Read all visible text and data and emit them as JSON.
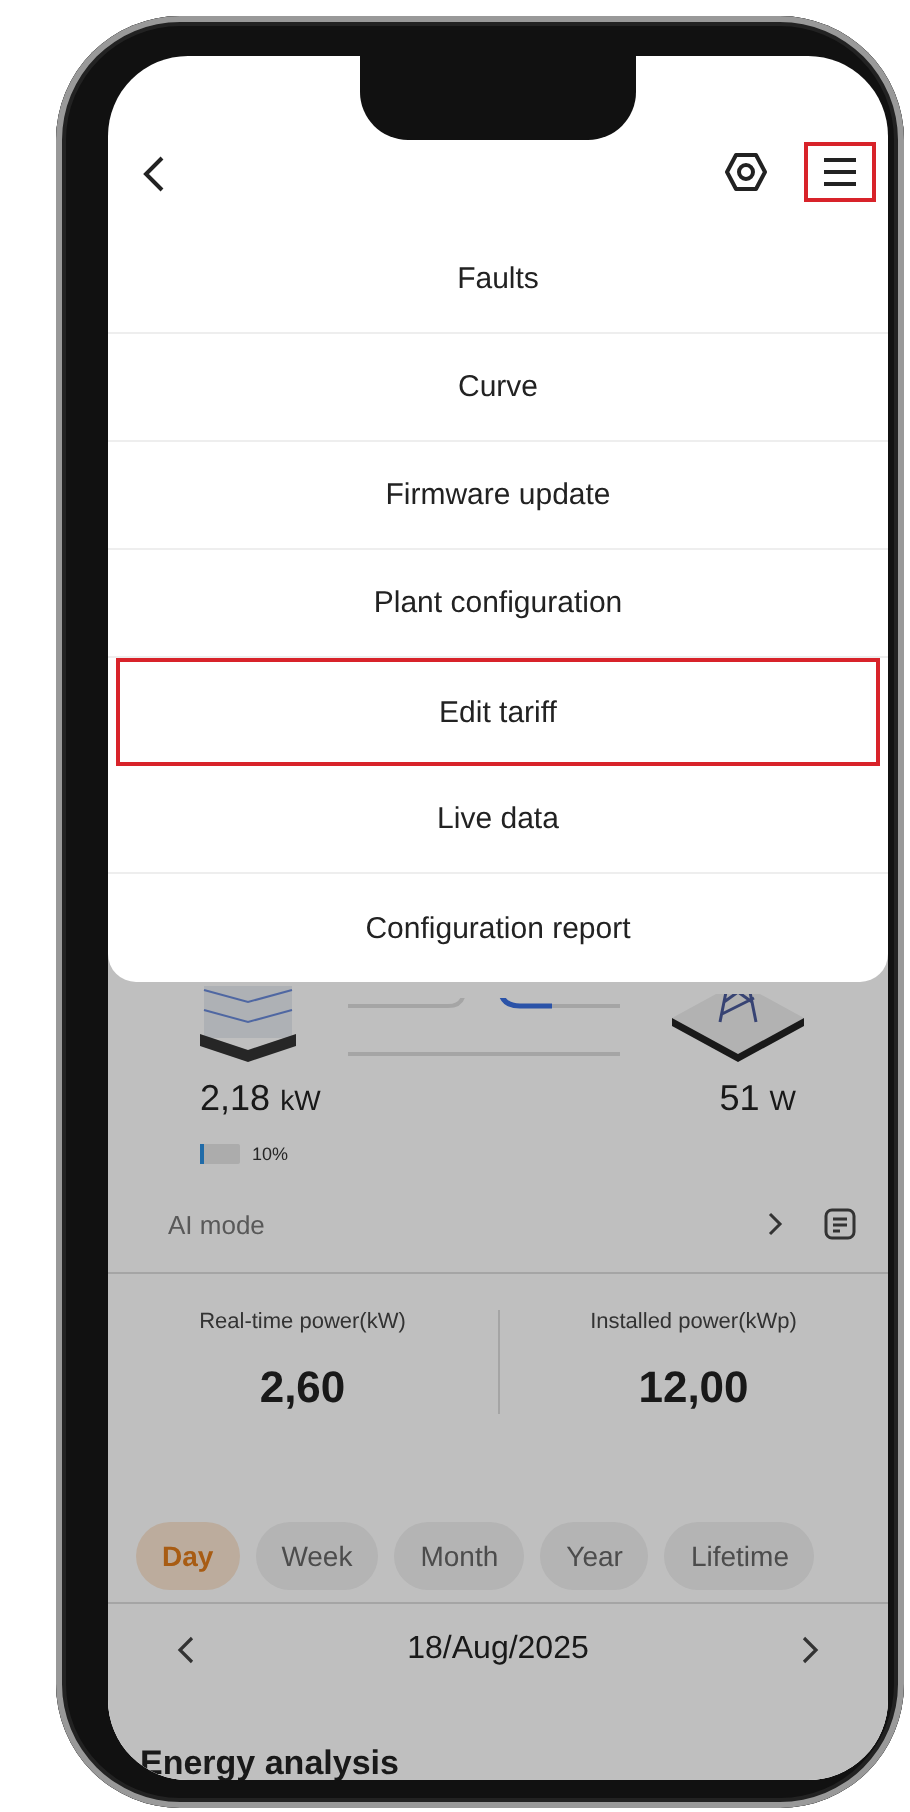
{
  "header": {
    "menu_button": {
      "highlighted": true
    }
  },
  "menu": {
    "items": [
      {
        "label": "Faults",
        "highlighted": false
      },
      {
        "label": "Curve",
        "highlighted": false
      },
      {
        "label": "Firmware update",
        "highlighted": false
      },
      {
        "label": "Plant configuration",
        "highlighted": false
      },
      {
        "label": "Edit tariff",
        "highlighted": true
      },
      {
        "label": "Live data",
        "highlighted": false
      },
      {
        "label": "Configuration report",
        "highlighted": false
      }
    ]
  },
  "energy_flow": {
    "battery": {
      "value": "2,18",
      "unit": "kW",
      "level": 0.1,
      "percent": "10%"
    },
    "grid": {
      "value": "51",
      "unit": "W"
    }
  },
  "mode_row": {
    "label": "AI mode"
  },
  "stats": [
    {
      "label": "Real-time power(kW)",
      "value": "2,60"
    },
    {
      "label": "Installed power(kWp)",
      "value": "12,00"
    }
  ],
  "period_tabs": [
    {
      "label": "Day",
      "selected": true
    },
    {
      "label": "Week",
      "selected": false
    },
    {
      "label": "Month",
      "selected": false
    },
    {
      "label": "Year",
      "selected": false
    },
    {
      "label": "Lifetime",
      "selected": false
    }
  ],
  "date": "18/Aug/2025",
  "section_title": "Energy analysis"
}
